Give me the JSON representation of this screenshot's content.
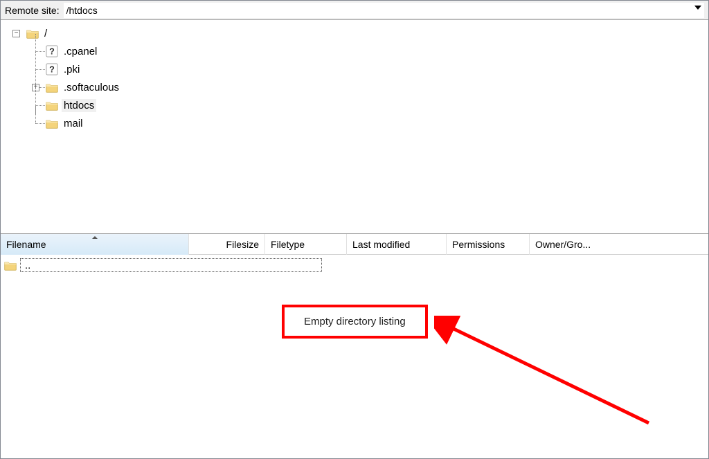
{
  "pathBar": {
    "label": "Remote site:",
    "value": "/htdocs"
  },
  "tree": {
    "root": "/",
    "children": [
      {
        "name": ".cpanel",
        "type": "unknown"
      },
      {
        "name": ".pki",
        "type": "unknown"
      },
      {
        "name": ".softaculous",
        "type": "folder",
        "expandable": true
      },
      {
        "name": "htdocs",
        "type": "folder",
        "selected": true
      },
      {
        "name": "mail",
        "type": "folder"
      }
    ]
  },
  "columns": {
    "filename": "Filename",
    "filesize": "Filesize",
    "filetype": "Filetype",
    "modified": "Last modified",
    "permissions": "Permissions",
    "owner": "Owner/Gro..."
  },
  "parentDirLabel": "..",
  "emptyMessage": "Empty directory listing"
}
